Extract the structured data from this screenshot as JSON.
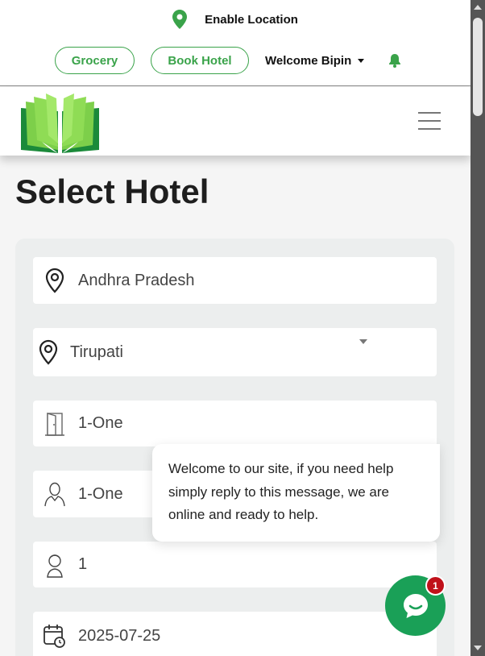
{
  "topbar": {
    "location_label": "Enable Location",
    "grocery_label": "Grocery",
    "book_hotel_label": "Book Hotel",
    "welcome_label": "Welcome Bipin"
  },
  "page": {
    "title": "Select Hotel"
  },
  "form": {
    "state": "Andhra Pradesh",
    "city": "Tirupati",
    "rooms": "1-One",
    "adults": "1-One",
    "children": "1",
    "date": "2025-07-25"
  },
  "chat": {
    "message": "Welcome to our site, if you need help simply reply to this message, we are online and ready to help.",
    "badge_count": "1"
  },
  "colors": {
    "brand_green": "#3aa34a",
    "chat_green": "#1aa057",
    "badge_red": "#c0111a"
  },
  "icons": [
    "location-pin-icon",
    "bell-icon",
    "hamburger-icon",
    "map-pin-icon",
    "door-icon",
    "person-icon",
    "child-icon",
    "calendar-icon",
    "chat-icon"
  ]
}
